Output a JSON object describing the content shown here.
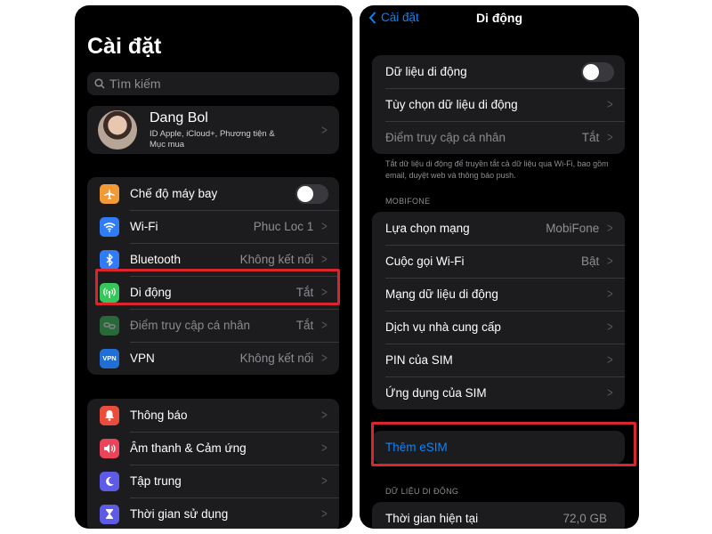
{
  "left_screen": {
    "title": "Cài đặt",
    "search_placeholder": "Tìm kiếm",
    "profile": {
      "name": "Dang Bol",
      "subtitle": "ID Apple, iCloud+, Phương tiện & Mục mua"
    },
    "group1": [
      {
        "label": "Chế độ máy bay",
        "value": "",
        "icon": "airplane-icon",
        "color": "#f19a37",
        "toggle": true
      },
      {
        "label": "Wi-Fi",
        "value": "Phuc Loc 1",
        "icon": "wifi-icon",
        "color": "#2f7cf6"
      },
      {
        "label": "Bluetooth",
        "value": "Không kết nối",
        "icon": "bluetooth-icon",
        "color": "#2f7cf6"
      },
      {
        "label": "Di động",
        "value": "Tắt",
        "icon": "cellular-icon",
        "color": "#35c759"
      },
      {
        "label": "Điểm truy cập cá nhân",
        "value": "Tắt",
        "icon": "hotspot-icon",
        "color": "#35c759"
      },
      {
        "label": "VPN",
        "value": "Không kết nối",
        "icon": "vpn-icon",
        "color": "#1f6fd6",
        "icon_text": "VPN"
      }
    ],
    "group2": [
      {
        "label": "Thông báo",
        "icon": "notification-icon",
        "color": "#eb4d3d"
      },
      {
        "label": "Âm thanh & Cảm ứng",
        "icon": "sound-icon",
        "color": "#eb445a"
      },
      {
        "label": "Tập trung",
        "icon": "moon-icon",
        "color": "#5e5ce6"
      },
      {
        "label": "Thời gian sử dụng",
        "icon": "hourglass-icon",
        "color": "#5e5ce6"
      }
    ]
  },
  "right_screen": {
    "back_label": "Cài đặt",
    "title": "Di động",
    "group1": [
      {
        "label": "Dữ liệu di động",
        "value": "",
        "toggle": true
      },
      {
        "label": "Tùy chọn dữ liệu di động",
        "value": ""
      },
      {
        "label": "Điểm truy cập cá nhân",
        "value": "Tắt"
      }
    ],
    "footnote": "Tắt dữ liệu di động để truyền tắt cả dữ liệu qua Wi-Fi, bao gồm email, duyệt web và thông báo push.",
    "carrier_header": "MOBIFONE",
    "group2": [
      {
        "label": "Lựa chọn mạng",
        "value": "MobiFone"
      },
      {
        "label": "Cuộc gọi Wi-Fi",
        "value": "Bật"
      },
      {
        "label": "Mạng dữ liệu di động",
        "value": ""
      },
      {
        "label": "Dịch vụ nhà cung cấp",
        "value": ""
      },
      {
        "label": "PIN của SIM",
        "value": ""
      },
      {
        "label": "Ứng dụng của SIM",
        "value": ""
      }
    ],
    "add_esim": "Thêm eSIM",
    "data_header": "DỮ LIỆU DI ĐỘNG",
    "group3": [
      {
        "label": "Thời gian hiện tại",
        "value": "72,0 GB"
      }
    ]
  },
  "colors": {
    "highlight": "#d9262e",
    "link": "#0a84ff"
  }
}
